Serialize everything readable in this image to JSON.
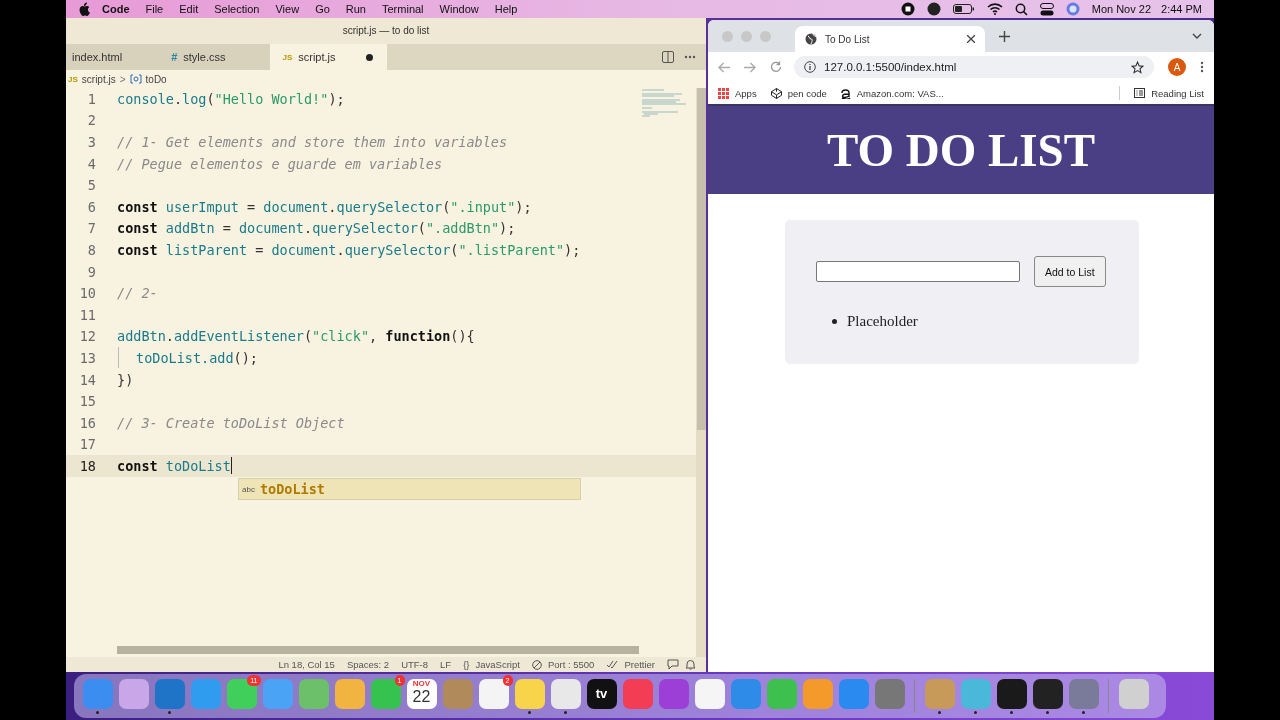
{
  "menu_bar": {
    "app": "Code",
    "items": [
      "File",
      "Edit",
      "Selection",
      "View",
      "Go",
      "Run",
      "Terminal",
      "Window",
      "Help"
    ],
    "date": "Mon Nov 22",
    "time": "2:44 PM"
  },
  "editor": {
    "title": "script.js — to do list",
    "tabs": [
      {
        "label": "index.html",
        "selected": false,
        "modified": false
      },
      {
        "label": "style.css",
        "icon": "#",
        "selected": false,
        "modified": false
      },
      {
        "label": "script.js",
        "icon": "JS",
        "selected": true,
        "modified": true
      }
    ],
    "breadcrumb": {
      "icon": "JS",
      "file": "script.js",
      "separator": ">",
      "symbol": "toDo"
    },
    "lines": [
      {
        "number": "1",
        "current": false,
        "indent": false,
        "tokens": [
          {
            "kind": "var",
            "text": "console"
          },
          {
            "kind": "punct",
            "text": "."
          },
          {
            "kind": "var",
            "text": "log"
          },
          {
            "kind": "punct",
            "text": "("
          },
          {
            "kind": "str",
            "text": "\"Hello World!\""
          },
          {
            "kind": "punct",
            "text": ");"
          }
        ]
      },
      {
        "number": "2",
        "current": false,
        "indent": false
      },
      {
        "number": "3",
        "current": false,
        "indent": false,
        "tokens": [
          {
            "kind": "comment",
            "text": "// 1- Get elements and store them into variables"
          }
        ]
      },
      {
        "number": "4",
        "current": false,
        "indent": false,
        "tokens": [
          {
            "kind": "comment",
            "text": "// Pegue elementos e guarde em variables"
          }
        ]
      },
      {
        "number": "5",
        "current": false,
        "indent": false
      },
      {
        "number": "6",
        "current": false,
        "indent": false,
        "tokens": [
          {
            "kind": "kw",
            "text": "const "
          },
          {
            "kind": "var",
            "text": "userImput"
          },
          {
            "kind": "punct",
            "text": " = "
          },
          {
            "kind": "var",
            "text": "document"
          },
          {
            "kind": "punct",
            "text": "."
          },
          {
            "kind": "var",
            "text": "querySelector"
          },
          {
            "kind": "punct",
            "text": "("
          },
          {
            "kind": "str",
            "text": "\".input\""
          },
          {
            "kind": "punct",
            "text": ");"
          }
        ]
      },
      {
        "number": "7",
        "current": false,
        "indent": false,
        "tokens": [
          {
            "kind": "kw",
            "text": "const "
          },
          {
            "kind": "var",
            "text": "addBtn"
          },
          {
            "kind": "punct",
            "text": " = "
          },
          {
            "kind": "var",
            "text": "document"
          },
          {
            "kind": "punct",
            "text": "."
          },
          {
            "kind": "var",
            "text": "querySelector"
          },
          {
            "kind": "punct",
            "text": "("
          },
          {
            "kind": "str",
            "text": "\".addBtn\""
          },
          {
            "kind": "punct",
            "text": ");"
          }
        ]
      },
      {
        "number": "8",
        "current": false,
        "indent": false,
        "tokens": [
          {
            "kind": "kw",
            "text": "const "
          },
          {
            "kind": "var",
            "text": "listParent"
          },
          {
            "kind": "punct",
            "text": " = "
          },
          {
            "kind": "var",
            "text": "document"
          },
          {
            "kind": "punct",
            "text": "."
          },
          {
            "kind": "var",
            "text": "querySelector"
          },
          {
            "kind": "punct",
            "text": "("
          },
          {
            "kind": "str",
            "text": "\".listParent\""
          },
          {
            "kind": "punct",
            "text": ");"
          }
        ]
      },
      {
        "number": "9",
        "current": false,
        "indent": false
      },
      {
        "number": "10",
        "current": false,
        "indent": false,
        "tokens": [
          {
            "kind": "comment",
            "text": "// 2-"
          }
        ]
      },
      {
        "number": "11",
        "current": false,
        "indent": false
      },
      {
        "number": "12",
        "current": false,
        "indent": false,
        "tokens": [
          {
            "kind": "var",
            "text": "addBtn"
          },
          {
            "kind": "punct",
            "text": "."
          },
          {
            "kind": "var",
            "text": "addEventListener"
          },
          {
            "kind": "punct",
            "text": "("
          },
          {
            "kind": "str",
            "text": "\"click\""
          },
          {
            "kind": "punct",
            "text": ", "
          },
          {
            "kind": "kw",
            "text": "function"
          },
          {
            "kind": "punct",
            "text": "(){"
          }
        ]
      },
      {
        "number": "13",
        "current": false,
        "indent": true,
        "tokens": [
          {
            "kind": "var",
            "text": "toDoList.add"
          },
          {
            "kind": "punct",
            "text": "();"
          }
        ]
      },
      {
        "number": "14",
        "current": false,
        "indent": false,
        "tokens": [
          {
            "kind": "punct",
            "text": "})"
          }
        ]
      },
      {
        "number": "15",
        "current": false,
        "indent": false
      },
      {
        "number": "16",
        "current": false,
        "indent": false,
        "tokens": [
          {
            "kind": "comment",
            "text": "// 3- Create toDoList Object"
          }
        ]
      },
      {
        "number": "17",
        "current": false,
        "indent": false
      },
      {
        "number": "18",
        "current": true,
        "indent": false,
        "tokens": [
          {
            "kind": "kw",
            "text": "const "
          },
          {
            "kind": "var",
            "text": "toDoList"
          }
        ]
      }
    ],
    "suggestion": {
      "icon": "abc",
      "text": "toDoList"
    },
    "status": {
      "position": "Ln 18, Col 15",
      "spaces": "Spaces: 2",
      "encoding": "UTF-8",
      "eol": "LF",
      "language_icon": "{}",
      "language": "JavaScript",
      "port": "Port : 5500",
      "formatter": "Prettier"
    }
  },
  "browser": {
    "tab": {
      "title": "To Do List"
    },
    "url": "127.0.0.1:5500/index.html",
    "avatar": "A",
    "bookmarks": [
      {
        "label": "Apps",
        "kind": "apps"
      },
      {
        "label": "pen code",
        "kind": "codepen"
      },
      {
        "label": "Amazon.com: VAS...",
        "kind": "amazon"
      }
    ],
    "reading_list": "Reading List",
    "page": {
      "heading": "TO DO LIST",
      "button": "Add to List",
      "items": [
        "Placeholder"
      ]
    }
  },
  "dock": [
    {
      "kind": "app",
      "color": "#3b8ef0",
      "running": true
    },
    {
      "kind": "app",
      "color": "#c8a6e8",
      "running": false
    },
    {
      "kind": "app",
      "color": "#1f74c8",
      "running": true
    },
    {
      "kind": "app",
      "color": "#2f9cf0",
      "running": false
    },
    {
      "kind": "app",
      "color": "#3fcf5a",
      "running": false,
      "badge": "11"
    },
    {
      "kind": "app",
      "color": "#4aa3f5",
      "running": false
    },
    {
      "kind": "app",
      "color": "#6cc06a",
      "running": false
    },
    {
      "kind": "app",
      "color": "#f2b440",
      "running": false
    },
    {
      "kind": "app",
      "color": "#35c24e",
      "running": false,
      "badge": "1"
    },
    {
      "kind": "calendar",
      "color": "#ffffff",
      "running": false,
      "month": "NOV",
      "day": "22"
    },
    {
      "kind": "app",
      "color": "#b08a5a",
      "running": false
    },
    {
      "kind": "app",
      "color": "#f4f4f4",
      "running": false,
      "badge": "2"
    },
    {
      "kind": "app",
      "color": "#f7d44a",
      "running": true
    },
    {
      "kind": "app",
      "color": "#e8e8e8",
      "running": true
    },
    {
      "kind": "tv",
      "color": "#111111",
      "running": false,
      "text": "tv"
    },
    {
      "kind": "app",
      "color": "#f23d55",
      "running": false
    },
    {
      "kind": "app",
      "color": "#9b3fd6",
      "running": false
    },
    {
      "kind": "app",
      "color": "#f5f5f5",
      "running": false
    },
    {
      "kind": "app",
      "color": "#2e8ce8",
      "running": false
    },
    {
      "kind": "app",
      "color": "#3ec04e",
      "running": false
    },
    {
      "kind": "app",
      "color": "#f39a2a",
      "running": false
    },
    {
      "kind": "app",
      "color": "#2a8af0",
      "running": false
    },
    {
      "kind": "app",
      "color": "#777777",
      "running": false
    },
    {
      "kind": "separator"
    },
    {
      "kind": "app",
      "color": "#c89a5a",
      "running": true
    },
    {
      "kind": "app",
      "color": "#4ab8d8",
      "running": true
    },
    {
      "kind": "app",
      "color": "#1a1a1a",
      "running": true
    },
    {
      "kind": "app",
      "color": "#222222",
      "running": true
    },
    {
      "kind": "app",
      "color": "#7a7a9a",
      "running": true
    },
    {
      "kind": "separator"
    },
    {
      "kind": "app",
      "color": "#d0d0d0",
      "running": false
    }
  ]
}
